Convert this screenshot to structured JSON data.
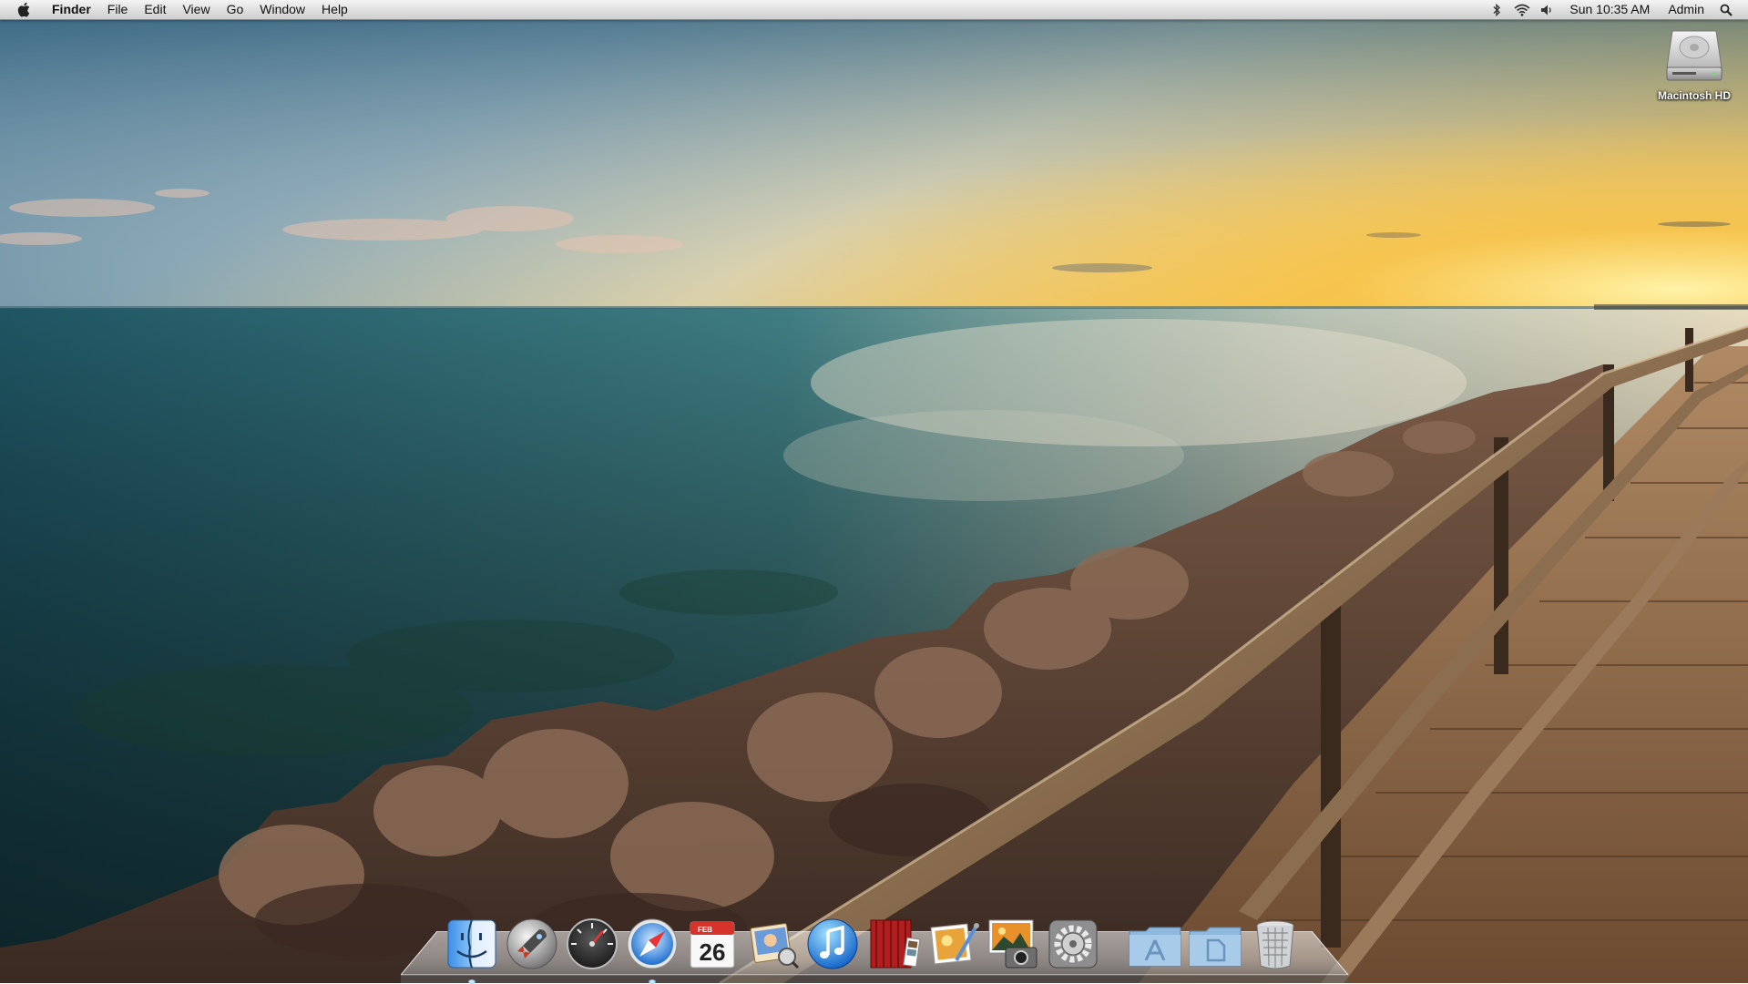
{
  "menubar": {
    "apple_icon": "apple-logo-icon",
    "app_name": "Finder",
    "menus": [
      "File",
      "Edit",
      "View",
      "Go",
      "Window",
      "Help"
    ],
    "status_icons": [
      "bluetooth-icon",
      "wifi-icon",
      "volume-icon"
    ],
    "clock": "Sun 10:35 AM",
    "user": "Admin",
    "spotlight_icon": "spotlight-search-icon"
  },
  "desktop": {
    "icons": [
      {
        "label": "Macintosh HD",
        "icon": "hard-drive-icon"
      }
    ]
  },
  "dock": {
    "items": [
      {
        "icon": "finder-icon",
        "running": true
      },
      {
        "icon": "launchpad-icon",
        "running": false
      },
      {
        "icon": "dashboard-icon",
        "running": false
      },
      {
        "icon": "safari-icon",
        "running": true
      },
      {
        "icon": "calendar-icon",
        "running": false,
        "month": "FEB",
        "day": "26"
      },
      {
        "icon": "address-book-icon",
        "running": false
      },
      {
        "icon": "itunes-icon",
        "running": false
      },
      {
        "icon": "photo-booth-icon",
        "running": false
      },
      {
        "icon": "preview-icon",
        "running": false
      },
      {
        "icon": "iphoto-icon",
        "running": false
      },
      {
        "icon": "system-preferences-icon",
        "running": false
      },
      {
        "icon": "applications-folder-icon",
        "running": false
      },
      {
        "icon": "documents-folder-icon",
        "running": false
      },
      {
        "icon": "trash-icon",
        "running": false
      }
    ]
  },
  "colors": {
    "menubar_bg": "#dcdcdc",
    "sky_top": "#4d7d99",
    "sunset": "#f6c64a",
    "sea": "#2f6a72",
    "boardwalk": "#7a5a3c"
  }
}
